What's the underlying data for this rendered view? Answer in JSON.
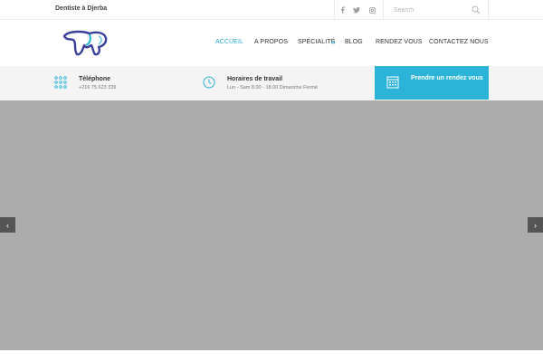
{
  "topbar": {
    "title": "Dentiste à Djerba",
    "search_placeholder": "Search",
    "social": [
      "facebook-icon",
      "twitter-icon",
      "instagram-icon"
    ]
  },
  "nav": {
    "items": [
      {
        "label": "ACCUEIL",
        "active": true
      },
      {
        "label": "A PROPOS",
        "active": false
      },
      {
        "label": "SPÉCIALITÉ",
        "active": false,
        "has_dropdown": true
      },
      {
        "label": "BLOG",
        "active": false
      },
      {
        "label": "RENDEZ VOUS",
        "active": false
      },
      {
        "label": "CONTACTEZ NOUS",
        "active": false
      }
    ]
  },
  "info": {
    "phone": {
      "title": "Téléphone",
      "value": "+216 75 623 339"
    },
    "hours": {
      "title": "Horaires de travail",
      "value": "Lun - Sam 8.00 - 18.00 Dimanche Fermé"
    },
    "cta": {
      "label": "Prendre un rendez vous"
    }
  },
  "slider": {
    "prev_symbol": "‹",
    "next_symbol": "›"
  },
  "colors": {
    "accent": "#2bb4d8",
    "slider_bg": "#acacac",
    "arrow_bg": "#555555",
    "infobar_bg": "#f4f4f4"
  }
}
